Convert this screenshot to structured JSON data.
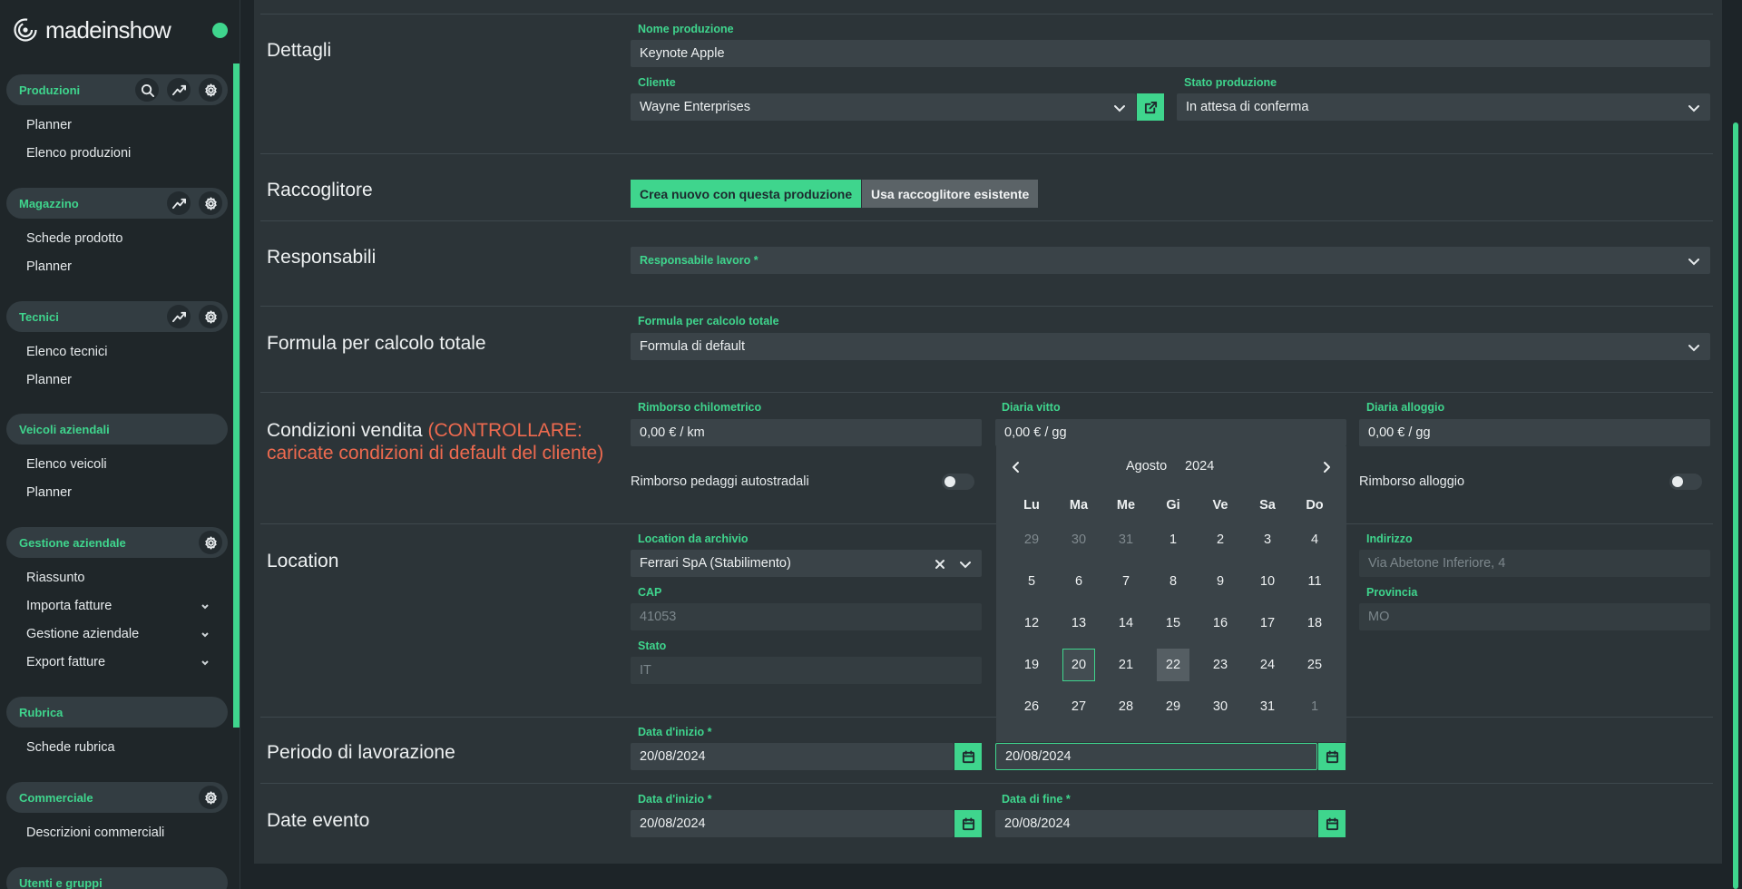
{
  "brand": {
    "name": "madeinshow",
    "status_color": "#3fd58d"
  },
  "sidebar": {
    "sections": [
      {
        "title": "Produzioni",
        "tools": [
          "search-icon",
          "chart-icon",
          "gear-icon"
        ],
        "items": [
          "Planner",
          "Elenco produzioni"
        ]
      },
      {
        "title": "Magazzino",
        "tools": [
          "chart-icon",
          "gear-icon"
        ],
        "items": [
          "Schede prodotto",
          "Planner"
        ]
      },
      {
        "title": "Tecnici",
        "tools": [
          "chart-icon",
          "gear-icon"
        ],
        "items": [
          "Elenco tecnici",
          "Planner"
        ]
      },
      {
        "title": "Veicoli aziendali",
        "tools": [],
        "items": [
          "Elenco veicoli",
          "Planner"
        ]
      },
      {
        "title": "Gestione aziendale",
        "tools": [
          "gear-icon"
        ],
        "items": [
          "Riassunto",
          "Importa fatture",
          "Gestione aziendale",
          "Export fatture"
        ]
      },
      {
        "title": "Rubrica",
        "tools": [],
        "items": [
          "Schede rubrica"
        ]
      },
      {
        "title": "Commerciale",
        "tools": [
          "gear-icon"
        ],
        "items": [
          "Descrizioni commerciali"
        ]
      },
      {
        "title": "Utenti e gruppi",
        "tools": [],
        "items": []
      }
    ]
  },
  "dettagli": {
    "title": "Dettagli",
    "nome_label": "Nome produzione",
    "nome_value": "Keynote Apple",
    "cliente_label": "Cliente",
    "cliente_value": "Wayne Enterprises",
    "stato_label": "Stato produzione",
    "stato_value": "In attesa di conferma"
  },
  "raccoglitore": {
    "title": "Raccoglitore",
    "option_new": "Crea nuovo con questa produzione",
    "option_existing": "Usa raccoglitore esistente",
    "selected": "Crea nuovo con questa produzione"
  },
  "responsabili": {
    "title": "Responsabili",
    "placeholder": "Responsabile lavoro *"
  },
  "formula": {
    "title": "Formula per calcolo totale",
    "label": "Formula per calcolo totale",
    "value": "Formula di default"
  },
  "condizioni": {
    "title": "Condizioni vendita",
    "warning_line1": "(CONTROLLARE:",
    "warning_line2": "caricate condizioni di default del cliente)",
    "rimborso_km_label": "Rimborso chilometrico",
    "rimborso_km_value": "0,00 € / km",
    "vitto_label": "Diaria vitto",
    "vitto_value": "0,00 € / gg",
    "alloggio_label": "Diaria alloggio",
    "alloggio_value": "0,00 € / gg",
    "pedaggi_label": "Rimborso pedaggi autostradali",
    "pedaggi_on": false,
    "rimborso_alloggio_label": "Rimborso alloggio",
    "rimborso_alloggio_on": false
  },
  "location": {
    "title": "Location",
    "archivio_label": "Location da archivio",
    "archivio_value": "Ferrari SpA (Stabilimento)",
    "cap_label": "CAP",
    "cap_value": "41053",
    "stato_label": "Stato",
    "stato_value": "IT",
    "indirizzo_label": "Indirizzo",
    "indirizzo_value": "Via Abetone Inferiore, 4",
    "provincia_label": "Provincia",
    "provincia_value": "MO"
  },
  "periodo": {
    "title": "Periodo di lavorazione",
    "inizio_label": "Data d'inizio *",
    "inizio_value": "20/08/2024",
    "fine_value": "20/08/2024"
  },
  "date_evento": {
    "title": "Date evento",
    "inizio_label": "Data d'inizio *",
    "inizio_value": "20/08/2024",
    "fine_label": "Data di fine *",
    "fine_value": "20/08/2024"
  },
  "calendar": {
    "month": "Agosto",
    "year": "2024",
    "weekdays": [
      "Lu",
      "Ma",
      "Me",
      "Gi",
      "Ve",
      "Sa",
      "Do"
    ],
    "weeks": [
      [
        "29",
        "30",
        "31",
        "1",
        "2",
        "3",
        "4"
      ],
      [
        "5",
        "6",
        "7",
        "8",
        "9",
        "10",
        "11"
      ],
      [
        "12",
        "13",
        "14",
        "15",
        "16",
        "17",
        "18"
      ],
      [
        "19",
        "20",
        "21",
        "22",
        "23",
        "24",
        "25"
      ],
      [
        "26",
        "27",
        "28",
        "29",
        "30",
        "31",
        "1"
      ]
    ],
    "muted_cells": [
      [
        0,
        0
      ],
      [
        0,
        1
      ],
      [
        0,
        2
      ],
      [
        4,
        6
      ]
    ],
    "selected_cell": [
      3,
      1
    ],
    "hover_cell": [
      3,
      3
    ]
  },
  "colors": {
    "accent": "#3fd58d",
    "warning": "#ee6a4f",
    "panel": "#2c3438"
  }
}
